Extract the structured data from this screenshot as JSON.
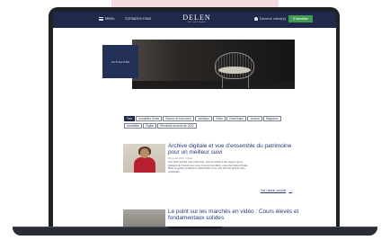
{
  "navbar": {
    "menu_label": "Menu",
    "contact_label": "Contactez-nous",
    "brand_name": "DELEN",
    "brand_sub": "PRIVATE BANK",
    "client_label": "Devenir client(e)",
    "cta_label": "S'identifier"
  },
  "hero": {
    "box_label": "Actualités"
  },
  "filters": {
    "row1": [
      "Tout",
      "Actualités Delen",
      "Bourse et économie",
      "Juridique",
      "Vidéo",
      "Numérique",
      "Journal",
      "Magazine"
    ],
    "row2": [
      "Actualités",
      "Digital",
      "Résultats annuels de 2022"
    ]
  },
  "articles": [
    {
      "title": "Archive digitale et vue d'ensemble du patrimoine pour un meilleur suivi",
      "meta": "25 janvier 2023 · Digital",
      "excerpt": "Pour Nele Vanhille votre patrimoine, vous le confiez à des experts qui se chargent de l'investir pour vous. C'est un bon début, mais chez Delen Private Bank, la gestion prudente et responsable va un cran plus loin qu'à de votre portefeuille...",
      "link_label": "Voir l'article complet"
    },
    {
      "title": "Le point sur les marchés en vidéo : Cours élevés et fondamentaux solides"
    }
  ]
}
